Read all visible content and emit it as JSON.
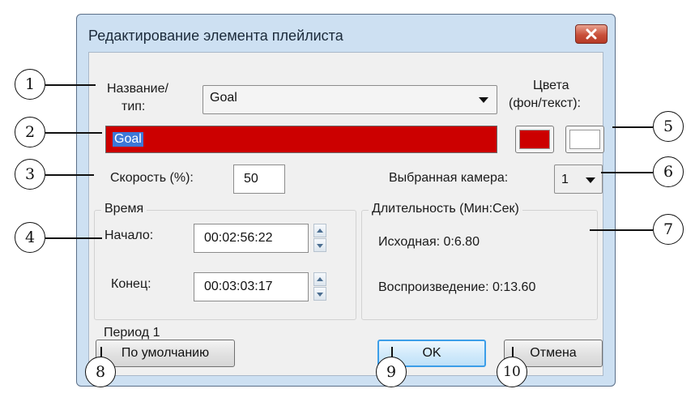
{
  "dialog": {
    "title": "Редактирование элемента плейлиста",
    "close_icon": "close-icon"
  },
  "name_type": {
    "label_line1": "Название/",
    "label_line2": "тип:",
    "selected": "Goal",
    "name_value": "Goal"
  },
  "colors": {
    "label_line1": "Цвета",
    "label_line2": "(фон/текст):",
    "background": "#cc0000",
    "text": "#ffffff"
  },
  "speed": {
    "label": "Скорость (%):",
    "value": "50"
  },
  "camera": {
    "label": "Выбранная камера:",
    "value": "1"
  },
  "time_group": {
    "title": "Время",
    "start_label": "Начало:",
    "start_value": "00:02:56:22",
    "end_label": "Конец:",
    "end_value": "00:03:03:17"
  },
  "duration_group": {
    "title": "Длительность (Мин:Сек)",
    "source": "Исходная: 0:6.80",
    "playback": "Воспроизведение: 0:13.60"
  },
  "period": "Период 1",
  "buttons": {
    "default": "По умолчанию",
    "ok": "OK",
    "cancel": "Отмена"
  },
  "callouts": [
    "1",
    "2",
    "3",
    "4",
    "5",
    "6",
    "7",
    "8",
    "9",
    "10"
  ]
}
